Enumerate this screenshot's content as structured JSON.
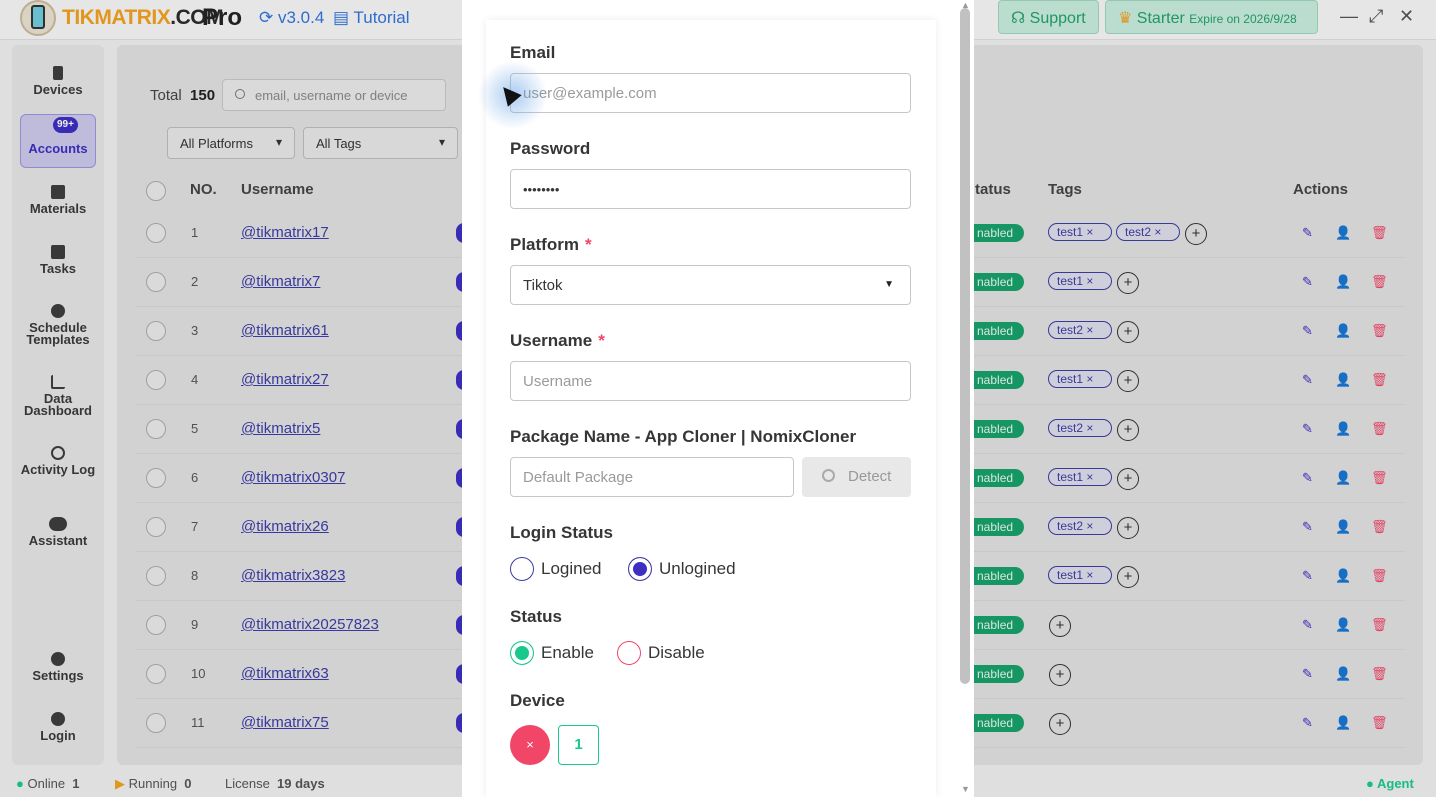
{
  "app": {
    "brand_tik": "TIKMATRIX",
    "brand_com": ".COM",
    "edition": "Pro",
    "version": "v3.0.4",
    "tutorial": "Tutorial",
    "support": "Support",
    "plan": "Starter",
    "expire": "Expire on 2026/9/28"
  },
  "sidebar": {
    "items": [
      {
        "label": "Devices",
        "icon": "phone-icon"
      },
      {
        "label": "Accounts",
        "icon": "user-icon",
        "badge": "99+",
        "active": true
      },
      {
        "label": "Materials",
        "icon": "film-icon"
      },
      {
        "label": "Tasks",
        "icon": "list-icon"
      },
      {
        "label": "Schedule Templates",
        "icon": "clock-icon"
      },
      {
        "label": "Data Dashboard",
        "icon": "chart-icon"
      },
      {
        "label": "Activity Log",
        "icon": "history-icon"
      },
      {
        "label": "Assistant",
        "icon": "chat-icon"
      },
      {
        "label": "Settings",
        "icon": "gear-icon"
      },
      {
        "label": "Login",
        "icon": "user-circle-icon"
      }
    ]
  },
  "toolbar": {
    "total_label": "Total",
    "total_value": "150",
    "search_placeholder": "email, username or device",
    "platforms": "All Platforms",
    "tags": "All Tags"
  },
  "table": {
    "headers": {
      "no": "NO.",
      "username": "Username",
      "status": "tatus",
      "tags": "Tags",
      "actions": "Actions"
    },
    "rows": [
      {
        "no": "1",
        "username": "@tikmatrix17",
        "status": "nabled",
        "tags": [
          "test1",
          "test2"
        ]
      },
      {
        "no": "2",
        "username": "@tikmatrix7",
        "status": "nabled",
        "tags": [
          "test1"
        ]
      },
      {
        "no": "3",
        "username": "@tikmatrix61",
        "status": "nabled",
        "tags": [
          "test2"
        ]
      },
      {
        "no": "4",
        "username": "@tikmatrix27",
        "status": "nabled",
        "tags": [
          "test1"
        ]
      },
      {
        "no": "5",
        "username": "@tikmatrix5",
        "status": "nabled",
        "tags": [
          "test2"
        ]
      },
      {
        "no": "6",
        "username": "@tikmatrix0307",
        "status": "nabled",
        "tags": [
          "test1"
        ]
      },
      {
        "no": "7",
        "username": "@tikmatrix26",
        "status": "nabled",
        "tags": [
          "test2"
        ]
      },
      {
        "no": "8",
        "username": "@tikmatrix3823",
        "status": "nabled",
        "tags": [
          "test1"
        ]
      },
      {
        "no": "9",
        "username": "@tikmatrix20257823",
        "status": "nabled",
        "tags": []
      },
      {
        "no": "10",
        "username": "@tikmatrix63",
        "status": "nabled",
        "tags": []
      },
      {
        "no": "11",
        "username": "@tikmatrix75",
        "status": "nabled",
        "tags": []
      }
    ]
  },
  "statusbar": {
    "online_label": "Online",
    "online_value": "1",
    "running_label": "Running",
    "running_value": "0",
    "license_label": "License",
    "license_value": "19 days",
    "agent": "Agent"
  },
  "form": {
    "email_label": "Email",
    "email_placeholder": "user@example.com",
    "password_label": "Password",
    "password_value": "••••••••",
    "platform_label": "Platform",
    "platform_value": "Tiktok",
    "username_label": "Username",
    "username_placeholder": "Username",
    "package_label": "Package Name - App Cloner | NomixCloner",
    "package_placeholder": "Default Package",
    "detect": "Detect",
    "login_status_label": "Login Status",
    "logined": "Logined",
    "unlogined": "Unlogined",
    "status_label": "Status",
    "enable": "Enable",
    "disable": "Disable",
    "device_label": "Device",
    "device_remove": "×",
    "device_value": "1",
    "required_mark": "*"
  },
  "colors": {
    "accent": "#3d2fc0",
    "success": "#19c88e",
    "danger": "#f14668",
    "link": "#3273dc"
  }
}
